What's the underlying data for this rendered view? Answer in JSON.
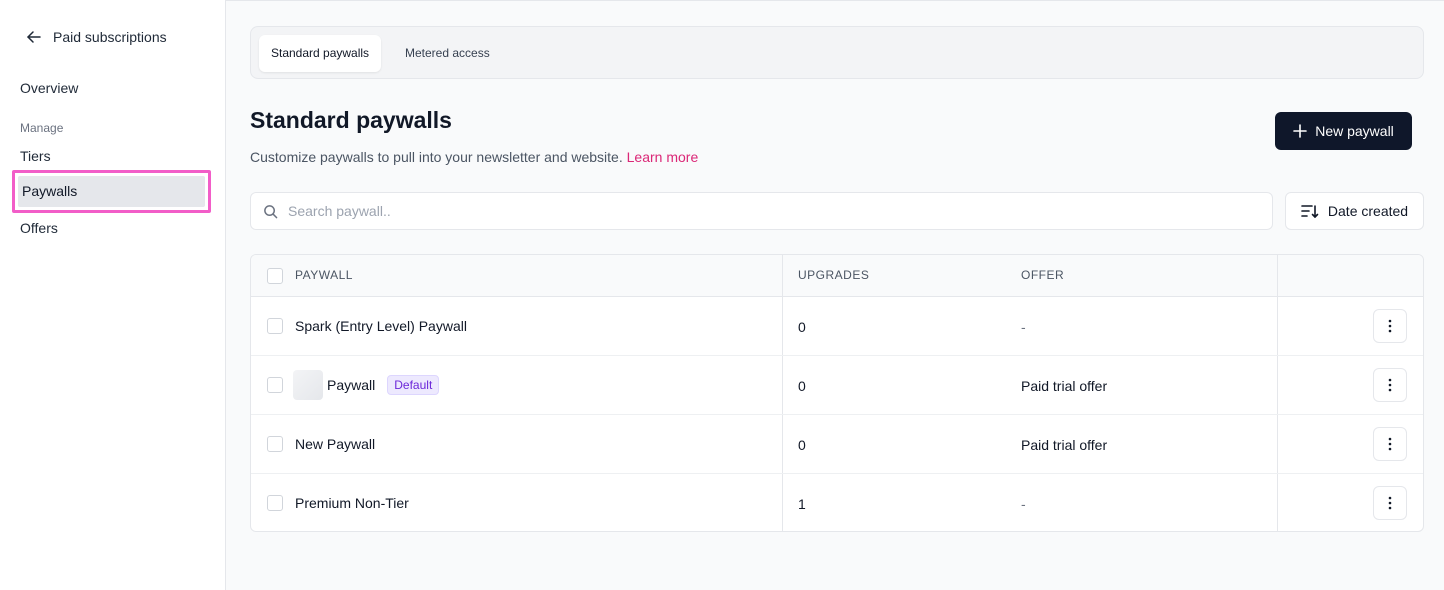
{
  "sidebar": {
    "back_label": "Paid subscriptions",
    "overview": "Overview",
    "section_label": "Manage",
    "items": [
      "Tiers",
      "Paywalls",
      "Offers"
    ]
  },
  "tabs": [
    "Standard paywalls",
    "Metered access"
  ],
  "header": {
    "title": "Standard paywalls",
    "subtitle": "Customize paywalls to pull into your newsletter and website.",
    "learn_more": "Learn more",
    "new_button": "New paywall"
  },
  "search": {
    "placeholder": "Search paywall.."
  },
  "sort": {
    "label": "Date created"
  },
  "table": {
    "columns": [
      "PAYWALL",
      "UPGRADES",
      "OFFER"
    ],
    "rows": [
      {
        "name": "Spark (Entry Level) Paywall",
        "upgrades": "0",
        "offer": "-",
        "badge": ""
      },
      {
        "name": "Paywall",
        "upgrades": "0",
        "offer": "Paid trial offer",
        "badge": "Default"
      },
      {
        "name": "New Paywall",
        "upgrades": "0",
        "offer": "Paid trial offer",
        "badge": ""
      },
      {
        "name": "Premium Non-Tier",
        "upgrades": "1",
        "offer": "-",
        "badge": ""
      }
    ]
  },
  "colors": {
    "accent": "#db2777",
    "highlight_border": "#f25dc8",
    "primary_button": "#0f172a",
    "badge_bg": "#ede9fe",
    "badge_text": "#6d28d9"
  }
}
